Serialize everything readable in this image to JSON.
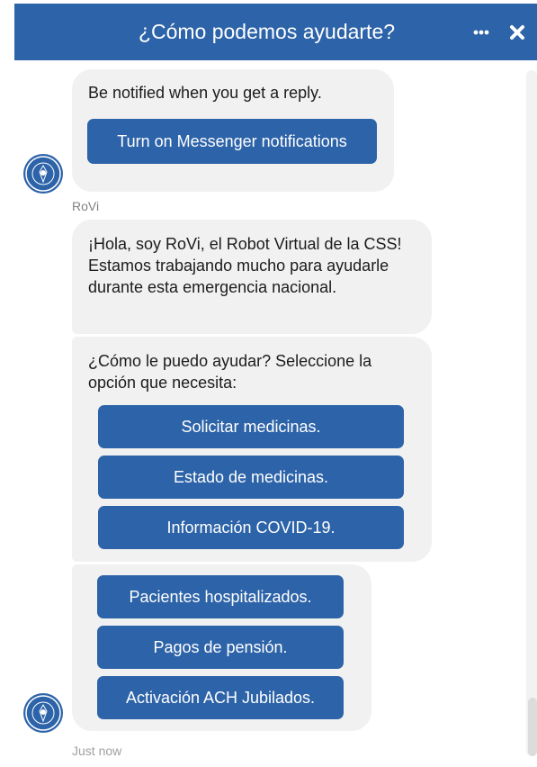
{
  "header": {
    "title": "¿Cómo podemos ayudarte?",
    "more_icon": "more-horizontal-icon",
    "close_icon": "close-icon",
    "color": "#2d63a8"
  },
  "conversation": {
    "notification_bubble": {
      "text": "Be notified when you get a reply.",
      "button_label": "Turn on Messenger notifications"
    },
    "sender_name": "RoVi",
    "greeting": "¡Hola, soy RoVi, el Robot Virtual de la CSS! Estamos trabajando mucho para ayudarle durante esta emergencia nacional.",
    "prompt": "¿Cómo le puedo ayudar? Seleccione la opción que necesita:",
    "options_group_1": [
      "Solicitar medicinas.",
      "Estado de medicinas.",
      "Información COVID-19."
    ],
    "options_group_2": [
      "Pacientes hospitalizados.",
      "Pagos de pensión.",
      "Activación ACH Jubilados."
    ],
    "timestamp": "Just now"
  },
  "colors": {
    "accent": "#2d63a8",
    "bubble": "#f1f1f1",
    "text": "#1c1c1c"
  }
}
